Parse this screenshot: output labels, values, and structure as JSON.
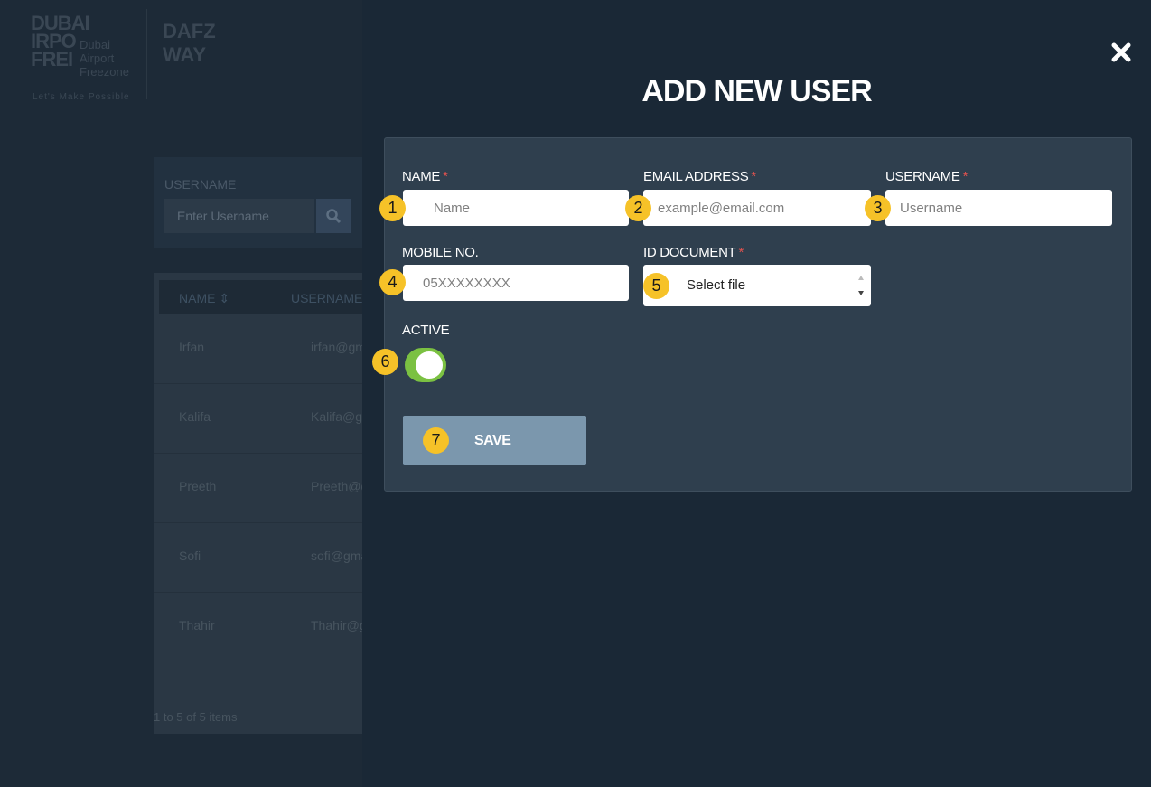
{
  "background": {
    "logo": {
      "big_lines": "DUBAI\nIRPO\nFREI",
      "small_lines": "Dubai\nAirport\nFreezone",
      "tagline": "Let's Make Possible"
    },
    "app_name": "DAFZ\nWAY",
    "filter": {
      "label": "USERNAME",
      "placeholder": "Enter Username",
      "search_icon": "search-icon"
    },
    "grid": {
      "columns": [
        "NAME ⇕",
        "USERNAME"
      ],
      "rows": [
        {
          "name": "Irfan",
          "username": "irfan@gm"
        },
        {
          "name": "Kalifa",
          "username": "Kalifa@gr"
        },
        {
          "name": "Preeth",
          "username": "Preeth@g"
        },
        {
          "name": "Sofi",
          "username": "sofi@gma"
        },
        {
          "name": "Thahir",
          "username": "Thahir@g"
        }
      ],
      "footer": "1 to 5 of 5 items"
    }
  },
  "modal": {
    "title": "ADD NEW USER",
    "close_icon": "close-icon",
    "fields": {
      "name": {
        "label": "NAME",
        "required_mark": "*",
        "placeholder": "Name"
      },
      "email": {
        "label": "EMAIL ADDRESS",
        "required_mark": "*",
        "placeholder": "example@email.com"
      },
      "username": {
        "label": "USERNAME",
        "required_mark": "*",
        "placeholder": "Username"
      },
      "mobile": {
        "label": "MOBILE NO.",
        "placeholder": "05XXXXXXXX"
      },
      "id_document": {
        "label": "ID DOCUMENT",
        "required_mark": "*",
        "selected": "Select file"
      },
      "active": {
        "label": "ACTIVE",
        "on": true
      }
    },
    "save_label": "SAVE",
    "badges": [
      "1",
      "2",
      "3",
      "4",
      "5",
      "6",
      "7"
    ],
    "colors": {
      "toggle_on": "#7bc142",
      "save_button": "#7b97ad",
      "required": "#e0524f",
      "badge": "#f6c228"
    }
  }
}
